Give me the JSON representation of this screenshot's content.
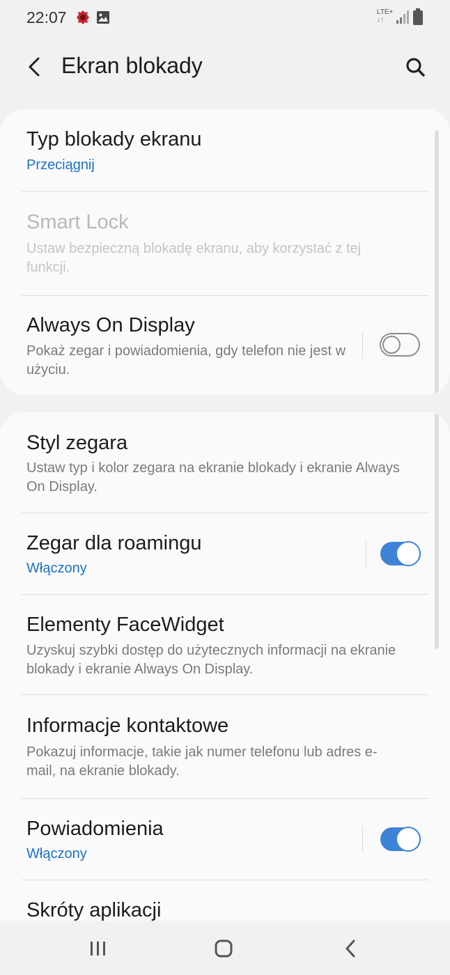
{
  "status_bar": {
    "time": "22:07",
    "left_icons": [
      "app-notification-icon",
      "image-icon"
    ],
    "network_label": "LTE+",
    "right_icons": [
      "signal-icon",
      "battery-icon"
    ]
  },
  "app_bar": {
    "title": "Ekran blokady",
    "back_icon": "back-arrow-icon",
    "search_icon": "search-icon"
  },
  "sections": [
    {
      "items": [
        {
          "title": "Typ blokady ekranu",
          "subtitle": "Przeciągnij",
          "subtitle_style": "accent",
          "enabled": true
        },
        {
          "title": "Smart Lock",
          "subtitle": "Ustaw bezpieczną blokadę ekranu, aby korzystać z tej funkcji.",
          "enabled": false
        },
        {
          "title": "Always On Display",
          "subtitle": "Pokaż zegar i powiadomienia, gdy telefon nie jest w użyciu.",
          "toggle": false,
          "enabled": true
        }
      ]
    },
    {
      "items": [
        {
          "title": "Styl zegara",
          "subtitle": "Ustaw typ i kolor zegara na ekranie blokady i ekranie Always On Display.",
          "enabled": true
        },
        {
          "title": "Zegar dla roamingu",
          "subtitle": "Włączony",
          "subtitle_style": "accent",
          "toggle": true,
          "enabled": true
        },
        {
          "title": "Elementy FaceWidget",
          "subtitle": "Uzyskuj szybki dostęp do użytecznych informacji na ekranie blokady i ekranie Always On Display.",
          "enabled": true
        },
        {
          "title": "Informacje kontaktowe",
          "subtitle": "Pokazuj informacje, takie jak numer telefonu lub adres e-mail, na ekranie blokady.",
          "enabled": true
        },
        {
          "title": "Powiadomienia",
          "subtitle": "Włączony",
          "subtitle_style": "accent",
          "toggle": true,
          "enabled": true
        },
        {
          "title": "Skróty aplikacji",
          "enabled": true
        }
      ]
    }
  ],
  "nav_bar": {
    "buttons": [
      "recent-apps-icon",
      "home-icon",
      "back-icon"
    ]
  },
  "colors": {
    "accent": "#1a73c5",
    "toggle_on": "#3d83d6",
    "background": "#f1f1f1",
    "card": "#fafafa"
  }
}
